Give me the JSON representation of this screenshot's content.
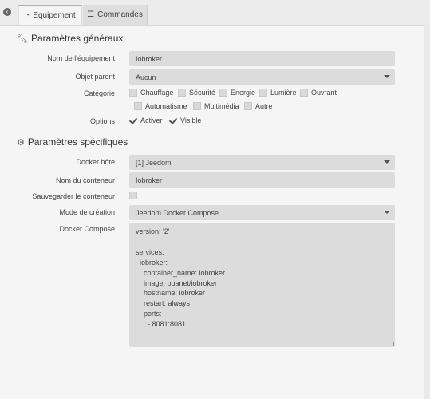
{
  "tabs": {
    "equipement": "Equipement",
    "commandes": "Commandes"
  },
  "sections": {
    "general": "Paramètres généraux",
    "specific": "Paramètres spécifiques"
  },
  "general": {
    "name_label": "Nom de l'équipement",
    "name_value": "Iobroker",
    "parent_label": "Objet parent",
    "parent_value": "Aucun",
    "category_label": "Catégorie",
    "categories": [
      "Chauffage",
      "Sécurité",
      "Energie",
      "Lumière",
      "Ouvrant",
      "Automatisme",
      "Multimédia",
      "Autre"
    ],
    "options_label": "Options",
    "options": [
      "Activer",
      "Visible"
    ]
  },
  "specific": {
    "docker_host_label": "Docker hôte",
    "docker_host_value": "[1] Jeedom",
    "container_name_label": "Nom du conteneur",
    "container_name_value": "Iobroker",
    "save_container_label": "Sauvegarder le conteneur",
    "creation_mode_label": "Mode de création",
    "creation_mode_value": "Jeedom Docker Compose",
    "compose_label": "Docker Compose",
    "compose_value": "version: '2'\n\nservices:\n  iobroker:\n    container_name: iobroker\n    image: buanet/iobroker\n    hostname: iobroker\n    restart: always\n    ports:\n      - 8081:8081"
  }
}
